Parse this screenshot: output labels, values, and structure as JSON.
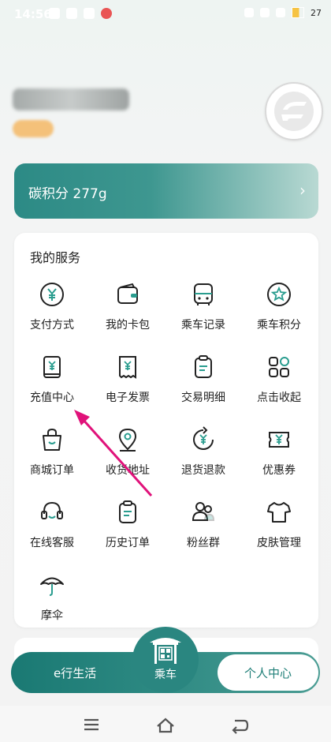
{
  "status_bar": {
    "time": "14:56",
    "battery": "27"
  },
  "carbon": {
    "label": "碳积分 277g",
    "chevron": "›"
  },
  "services": {
    "title": "我的服务",
    "items": [
      {
        "label": "支付方式",
        "icon": "yen-circle-icon"
      },
      {
        "label": "我的卡包",
        "icon": "wallet-icon"
      },
      {
        "label": "乘车记录",
        "icon": "bus-icon"
      },
      {
        "label": "乘车积分",
        "icon": "star-badge-icon"
      },
      {
        "label": "充值中心",
        "icon": "yen-book-icon"
      },
      {
        "label": "电子发票",
        "icon": "receipt-icon"
      },
      {
        "label": "交易明细",
        "icon": "clipboard-icon"
      },
      {
        "label": "点击收起",
        "icon": "grid-icon"
      },
      {
        "label": "商城订单",
        "icon": "shopping-bag-icon"
      },
      {
        "label": "收货地址",
        "icon": "location-pin-icon"
      },
      {
        "label": "退货退款",
        "icon": "refund-icon"
      },
      {
        "label": "优惠券",
        "icon": "coupon-icon"
      },
      {
        "label": "在线客服",
        "icon": "headset-icon"
      },
      {
        "label": "历史订单",
        "icon": "order-list-icon"
      },
      {
        "label": "粉丝群",
        "icon": "group-icon"
      },
      {
        "label": "皮肤管理",
        "icon": "tshirt-icon"
      },
      {
        "label": "摩伞",
        "icon": "umbrella-icon"
      }
    ]
  },
  "tabbar": {
    "life": "e行生活",
    "ride": "乘车",
    "personal": "个人中心"
  },
  "colors": {
    "accent": "#2a8680",
    "arrow": "#e0127a"
  }
}
